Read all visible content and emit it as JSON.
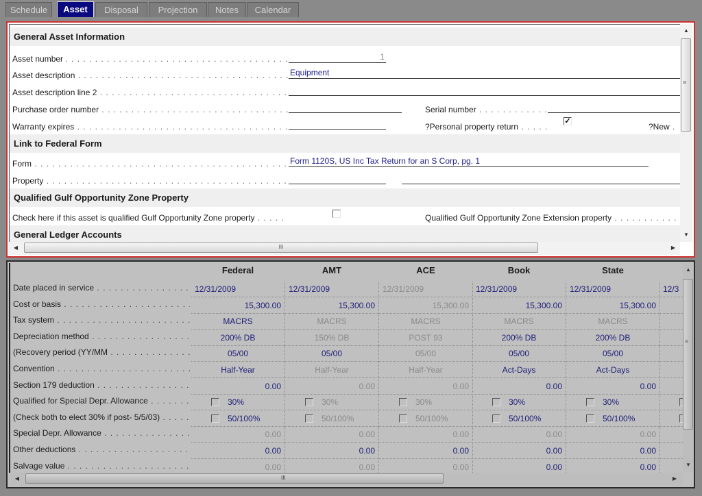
{
  "tabs": [
    {
      "label": "Schedule",
      "active": false
    },
    {
      "label": "Asset",
      "active": true
    },
    {
      "label": "Disposal",
      "active": false
    },
    {
      "label": "Projection",
      "active": false
    },
    {
      "label": "Notes",
      "active": false
    },
    {
      "label": "Calendar",
      "active": false
    }
  ],
  "general": {
    "header": "General Asset Information",
    "asset_number_label": "Asset number",
    "asset_number_value": "1",
    "asset_description_label": "Asset description",
    "asset_description_value": "Equipment",
    "asset_description2_label": "Asset description line 2",
    "asset_description2_value": "",
    "purchase_order_label": "Purchase order number",
    "purchase_order_value": "",
    "warranty_label": "Warranty expires",
    "warranty_value": "",
    "serial_label": "Serial number",
    "serial_value": "",
    "personal_property_label": "?Personal property return",
    "personal_property_checked": true,
    "new_label": "?New"
  },
  "federal_link": {
    "header": "Link to Federal Form",
    "form_label": "Form",
    "form_value": "Form 1120S, US Inc Tax Return for an S Corp, pg. 1",
    "property_label": "Property",
    "property_value1": "",
    "property_value2": ""
  },
  "gulf_zone": {
    "header": "Qualified Gulf Opportunity Zone Property",
    "check_label": "Check here if this asset is qualified Gulf Opportunity Zone property",
    "check_checked": false,
    "extension_label": "Qualified Gulf Opportunity Zone Extension property"
  },
  "ledger": {
    "header": "General Ledger Accounts"
  },
  "scroll_icons": {
    "up": "▲",
    "down": "▼",
    "left": "◀",
    "right": "▶",
    "grip_v": "≡",
    "grip_h": "III"
  },
  "depreciation": {
    "columns": [
      "Federal",
      "AMT",
      "ACE",
      "Book",
      "State"
    ],
    "partial_column_value": "12/3",
    "rows": [
      {
        "label": "Date placed in service",
        "align": "l",
        "values": [
          "12/31/2009",
          "12/31/2009",
          "12/31/2009",
          "12/31/2009",
          "12/31/2009"
        ],
        "enabled": [
          true,
          true,
          false,
          true,
          true
        ]
      },
      {
        "label": "Cost or basis",
        "align": "r",
        "values": [
          "15,300.00",
          "15,300.00",
          "15,300.00",
          "15,300.00",
          "15,300.00"
        ],
        "enabled": [
          true,
          true,
          false,
          true,
          true
        ]
      },
      {
        "label": "Tax system",
        "align": "c",
        "values": [
          "MACRS",
          "MACRS",
          "MACRS",
          "MACRS",
          "MACRS"
        ],
        "enabled": [
          true,
          false,
          false,
          false,
          false
        ]
      },
      {
        "label": "Depreciation method",
        "align": "c",
        "values": [
          "200% DB",
          "150% DB",
          "POST 93",
          "200% DB",
          "200% DB"
        ],
        "enabled": [
          true,
          false,
          false,
          true,
          true
        ]
      },
      {
        "label": "(Recovery period (YY/MM",
        "align": "c",
        "values": [
          "05/00",
          "05/00",
          "05/00",
          "05/00",
          "05/00"
        ],
        "enabled": [
          true,
          true,
          false,
          true,
          true
        ]
      },
      {
        "label": "Convention",
        "align": "c",
        "values": [
          "Half-Year",
          "Half-Year",
          "Half-Year",
          "Act-Days",
          "Act-Days"
        ],
        "enabled": [
          true,
          false,
          false,
          true,
          true
        ]
      },
      {
        "label": "Section 179 deduction",
        "align": "r",
        "values": [
          "0.00",
          "0.00",
          "0.00",
          "0.00",
          "0.00"
        ],
        "enabled": [
          true,
          false,
          false,
          true,
          true
        ]
      },
      {
        "label": "Qualified for Special Depr. Allowance",
        "align": "cb",
        "values": [
          "30%",
          "30%",
          "30%",
          "30%",
          "30%"
        ],
        "enabled": [
          true,
          false,
          false,
          true,
          true
        ]
      },
      {
        "label": "(Check both to elect 30% if post- 5/5/03)",
        "align": "cb",
        "values": [
          "50/100%",
          "50/100%",
          "50/100%",
          "50/100%",
          "50/100%"
        ],
        "enabled": [
          true,
          false,
          false,
          true,
          true
        ]
      },
      {
        "label": "Special Depr. Allowance",
        "align": "r",
        "values": [
          "0.00",
          "0.00",
          "0.00",
          "0.00",
          "0.00"
        ],
        "enabled": [
          false,
          false,
          false,
          false,
          false
        ]
      },
      {
        "label": "Other deductions",
        "align": "r",
        "values": [
          "0.00",
          "0.00",
          "0.00",
          "0.00",
          "0.00"
        ],
        "enabled": [
          true,
          true,
          true,
          true,
          true
        ]
      },
      {
        "label": "Salvage value",
        "align": "r",
        "values": [
          "0.00",
          "0.00",
          "0.00",
          "0.00",
          "0.00"
        ],
        "enabled": [
          false,
          false,
          false,
          true,
          true
        ]
      }
    ]
  },
  "colors": {
    "active_tab": "#0a0a80",
    "focus_border": "#d03030",
    "enabled_value": "#1e1e78",
    "disabled_value": "#8a8a8a"
  }
}
